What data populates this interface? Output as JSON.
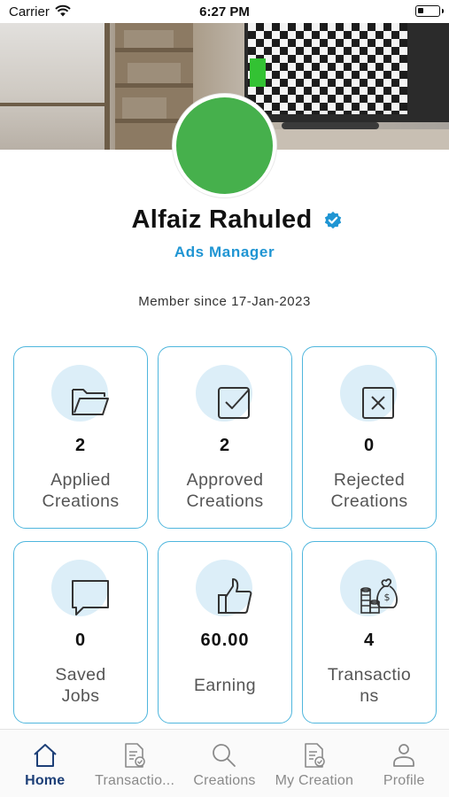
{
  "status_bar": {
    "carrier": "Carrier",
    "time": "6:27 PM"
  },
  "profile": {
    "name": "Alfaiz Rahuled",
    "role": "Ads Manager",
    "member_since": "Member since 17-Jan-2023"
  },
  "stats": [
    {
      "icon": "folder-icon",
      "count": "2",
      "label": "Applied\nCreations"
    },
    {
      "icon": "checkbox-icon",
      "count": "2",
      "label": "Approved\nCreations"
    },
    {
      "icon": "close-box-icon",
      "count": "0",
      "label": "Rejected\nCreations"
    },
    {
      "icon": "chat-bubble-icon",
      "count": "0",
      "label": "Saved\nJobs"
    },
    {
      "icon": "thumbs-up-icon",
      "count": "60.00",
      "label": "Earning"
    },
    {
      "icon": "money-bag-icon",
      "count": "4",
      "label": "Transactio\nns"
    }
  ],
  "tabs": [
    {
      "icon": "home-icon",
      "label": "Home",
      "active": true
    },
    {
      "icon": "document-icon",
      "label": "Transactio...",
      "active": false
    },
    {
      "icon": "search-icon",
      "label": "Creations",
      "active": false
    },
    {
      "icon": "document-icon",
      "label": "My Creation",
      "active": false
    },
    {
      "icon": "person-icon",
      "label": "Profile",
      "active": false
    }
  ],
  "colors": {
    "accent": "#1f95d3",
    "card_border": "#4fb6dd",
    "icon_bg": "#dceef8",
    "avatar": "#46b04c",
    "active_tab": "#1d3f77"
  }
}
